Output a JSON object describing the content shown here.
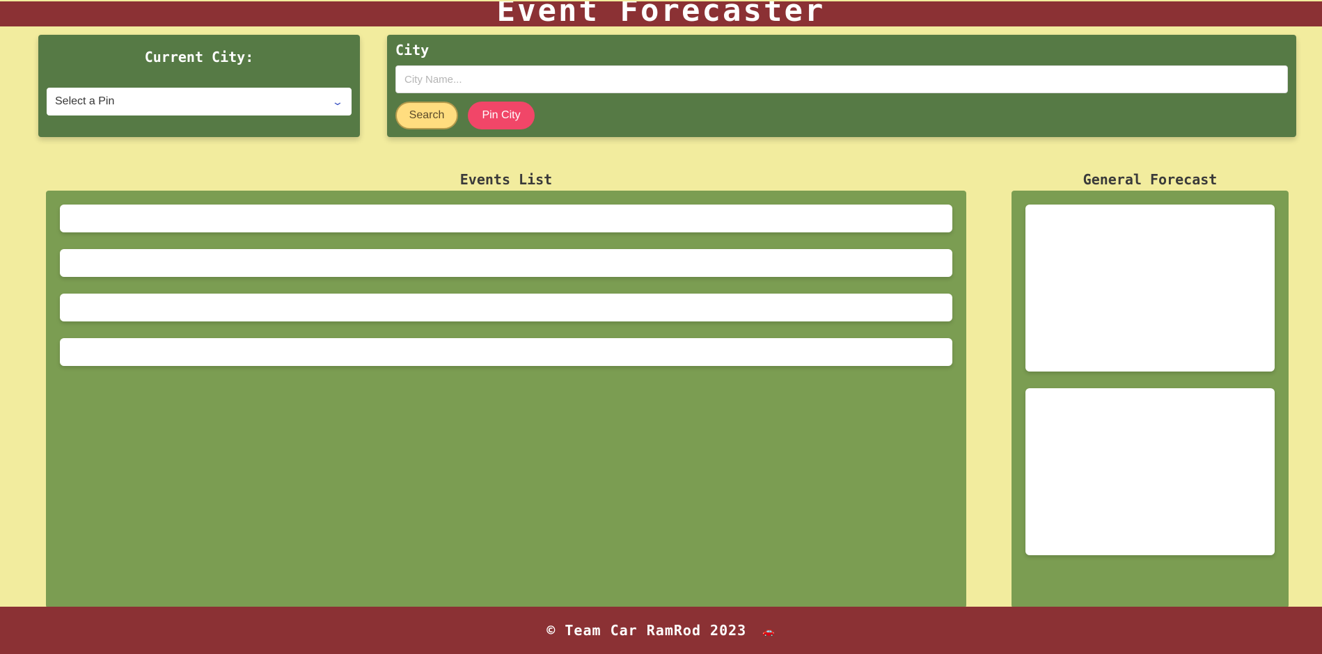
{
  "header": {
    "title": "Event Forecaster"
  },
  "current_city": {
    "heading": "Current City:",
    "select": {
      "selected": "Select a Pin",
      "icon": "chevron-down-icon"
    }
  },
  "city_search": {
    "label": "City",
    "input": {
      "placeholder": "City Name...",
      "value": ""
    },
    "search_button": "Search",
    "pin_button": "Pin City"
  },
  "events": {
    "title": "Events List",
    "items": [
      "",
      "",
      "",
      ""
    ]
  },
  "forecast": {
    "title": "General Forecast",
    "cards": [
      "",
      ""
    ]
  },
  "footer": {
    "text": "© Team Car RamRod 2023",
    "icon": "car-icon",
    "icon_glyph": "🚗"
  },
  "colors": {
    "header_bg": "#8b3134",
    "page_bg": "#f2ec9e",
    "panel_dark": "#567a45",
    "panel_light": "#7b9d52",
    "search_button": "#ffdd7f",
    "pin_button": "#f14668"
  }
}
